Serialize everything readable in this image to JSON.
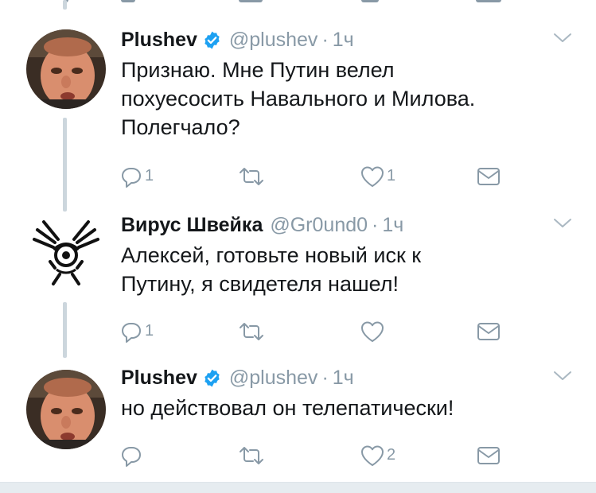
{
  "tweets": [
    {
      "name": "Plushev",
      "handle": "@plushev",
      "separator": "·",
      "time": "1ч",
      "verified": true,
      "avatar": "person-photo-avatar",
      "text_lines": [
        "Признаю. Мне Путин велел",
        "похуесосить Навального и Милова.",
        "Полегчало?"
      ],
      "reply_count": "1",
      "retweet_count": "",
      "like_count": "1"
    },
    {
      "name": "Вирус Швейка",
      "handle": "@Gr0und0",
      "separator": "·",
      "time": "1ч",
      "verified": false,
      "avatar": "dishonored-outsider-mark-avatar",
      "text_lines": [
        "Алексей, готовьте новый иск к",
        "Путину, я свидетеля нашел!"
      ],
      "reply_count": "1",
      "retweet_count": "",
      "like_count": ""
    },
    {
      "name": "Plushev",
      "handle": "@plushev",
      "separator": "·",
      "time": "1ч",
      "verified": true,
      "avatar": "person-photo-avatar",
      "text_lines": [
        "но действовал он телепатически!"
      ],
      "reply_count": "",
      "retweet_count": "",
      "like_count": "2"
    }
  ],
  "colors": {
    "text": "#14171a",
    "muted": "#8899a6",
    "verified_blue": "#1da1f2",
    "thread_line": "#ccd6dd"
  }
}
